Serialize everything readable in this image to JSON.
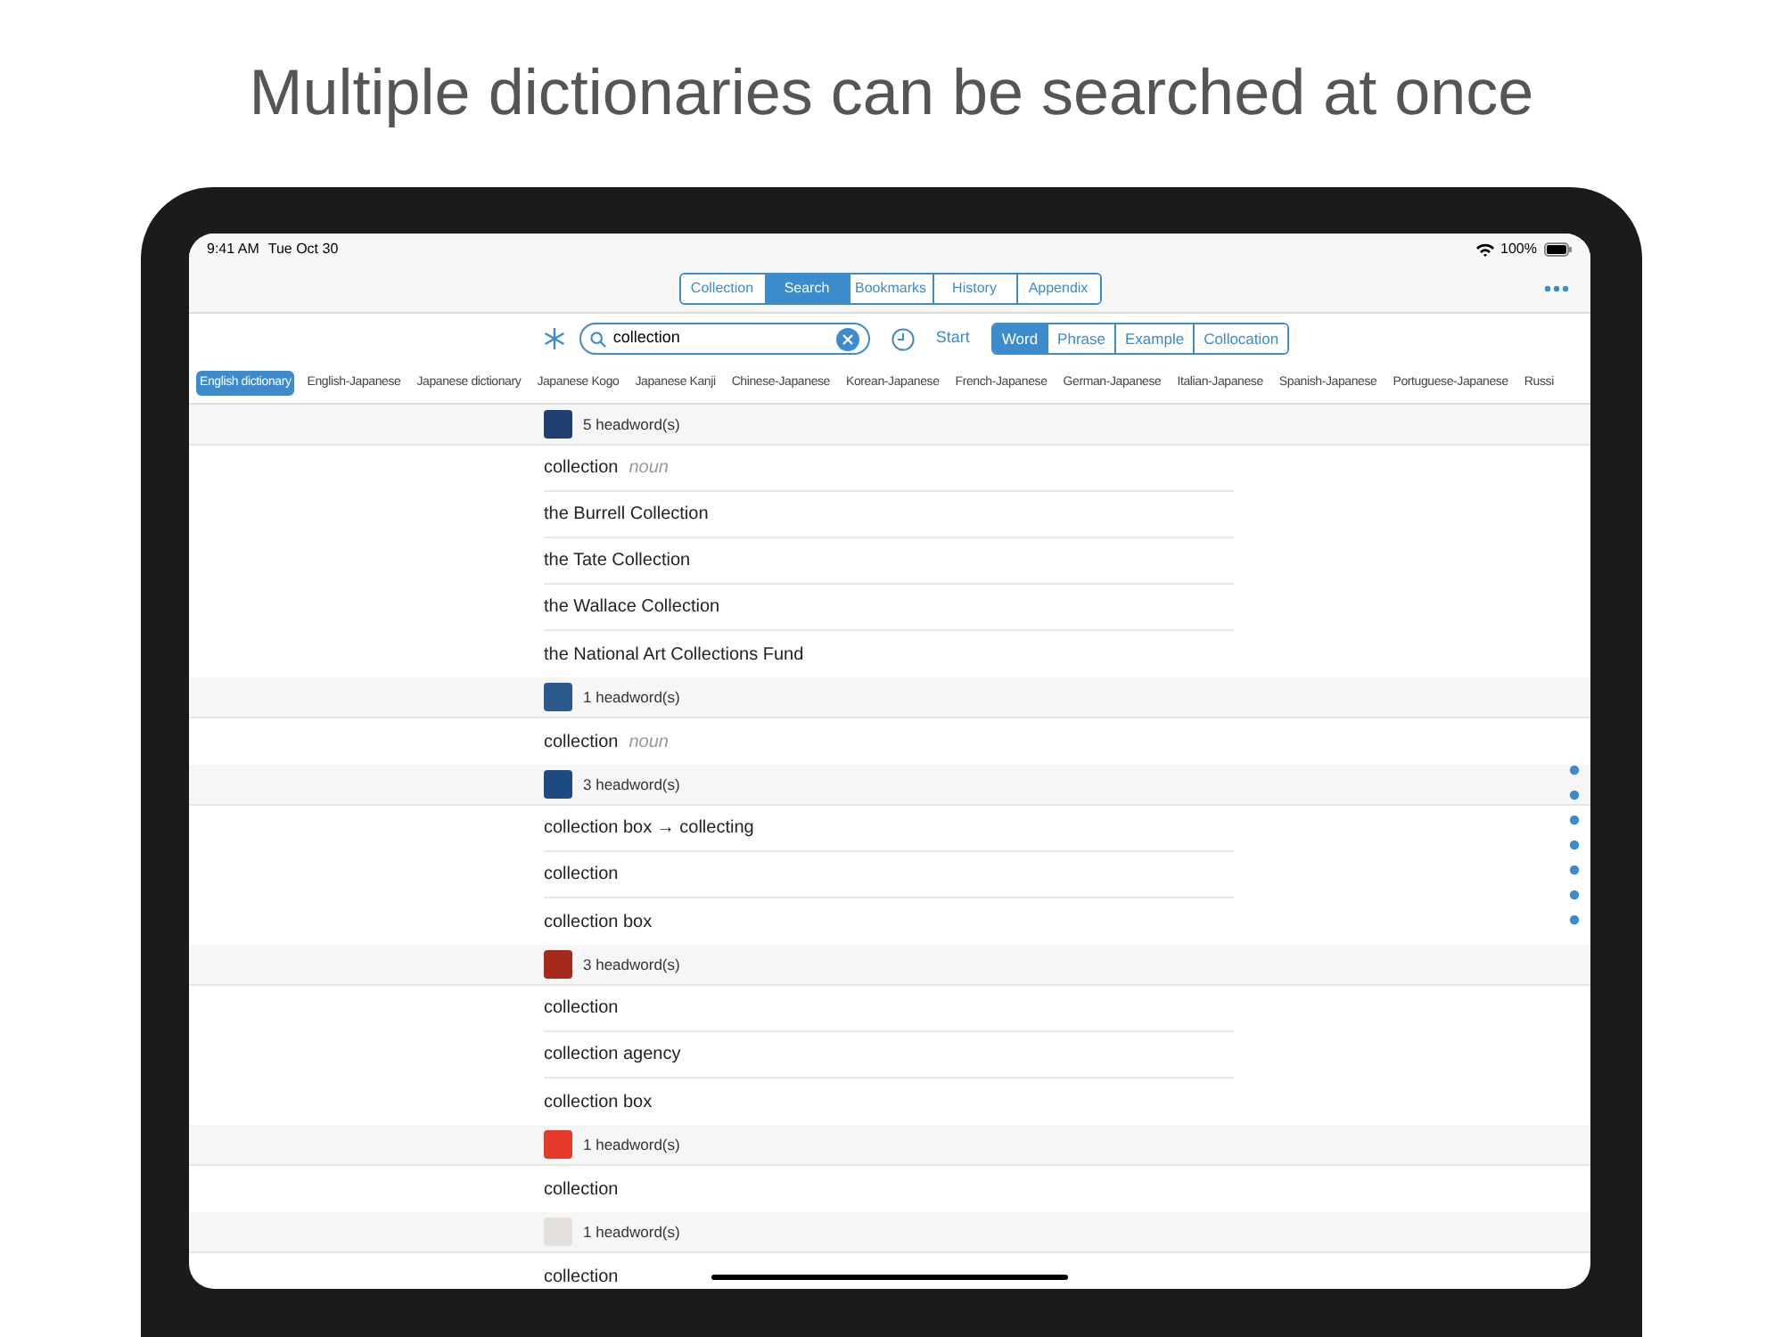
{
  "headline": "Multiple dictionaries can be searched at once",
  "status_bar": {
    "time": "9:41 AM",
    "date": "Tue Oct 30",
    "battery": "100%"
  },
  "tabs": [
    {
      "label": "Collection",
      "selected": false
    },
    {
      "label": "Search",
      "selected": true
    },
    {
      "label": "Bookmarks",
      "selected": false
    },
    {
      "label": "History",
      "selected": false
    },
    {
      "label": "Appendix",
      "selected": false
    }
  ],
  "search": {
    "value": "collection",
    "start": "Start"
  },
  "modes": [
    {
      "label": "Word",
      "selected": true
    },
    {
      "label": "Phrase",
      "selected": false
    },
    {
      "label": "Example",
      "selected": false
    },
    {
      "label": "Collocation",
      "selected": false
    }
  ],
  "dictionaries": [
    {
      "label": "English dictionary",
      "selected": true
    },
    {
      "label": "English-Japanese",
      "selected": false
    },
    {
      "label": "Japanese dictionary",
      "selected": false
    },
    {
      "label": "Japanese Kogo",
      "selected": false
    },
    {
      "label": "Japanese Kanji",
      "selected": false
    },
    {
      "label": "Chinese-Japanese",
      "selected": false
    },
    {
      "label": "Korean-Japanese",
      "selected": false
    },
    {
      "label": "French-Japanese",
      "selected": false
    },
    {
      "label": "German-Japanese",
      "selected": false
    },
    {
      "label": "Italian-Japanese",
      "selected": false
    },
    {
      "label": "Spanish-Japanese",
      "selected": false
    },
    {
      "label": "Portuguese-Japanese",
      "selected": false
    },
    {
      "label": "Russi",
      "selected": false
    }
  ],
  "results": [
    {
      "count": "5 headword(s)",
      "color": "#1f3f73",
      "entries": [
        {
          "word": "collection",
          "pos": "noun"
        },
        {
          "word": "the Burrell Collection"
        },
        {
          "word": "the Tate Collection"
        },
        {
          "word": "the Wallace Collection"
        },
        {
          "word": "the National Art Collections Fund"
        }
      ]
    },
    {
      "count": "1 headword(s)",
      "color": "#2a5a8c",
      "entries": [
        {
          "word": "collection",
          "pos": "noun"
        }
      ]
    },
    {
      "count": "3 headword(s)",
      "color": "#1d4a80",
      "entries": [
        {
          "word": "collection box → collecting"
        },
        {
          "word": "collection"
        },
        {
          "word": "collection box"
        }
      ]
    },
    {
      "count": "3 headword(s)",
      "color": "#a52a1c",
      "entries": [
        {
          "word": "collection"
        },
        {
          "word": "collection agency"
        },
        {
          "word": "collection box"
        }
      ]
    },
    {
      "count": "1 headword(s)",
      "color": "#e5392a",
      "entries": [
        {
          "word": "collection"
        }
      ]
    },
    {
      "count": "1 headword(s)",
      "color": "#e4e0dc",
      "entries": [
        {
          "word": "collection"
        }
      ]
    }
  ]
}
